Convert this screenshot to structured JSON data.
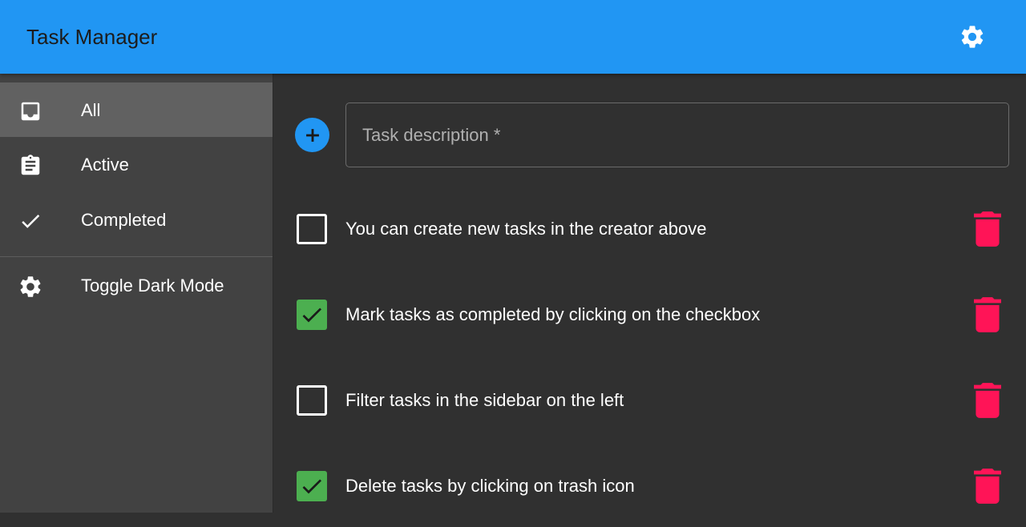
{
  "app": {
    "title": "Task Manager",
    "settings_icon": "gear-icon"
  },
  "sidebar": {
    "items": [
      {
        "label": "All",
        "icon": "inbox-icon",
        "selected": true
      },
      {
        "label": "Active",
        "icon": "clipboard-icon",
        "selected": false
      },
      {
        "label": "Completed",
        "icon": "checkmark-icon",
        "selected": false
      },
      {
        "label": "Toggle Dark Mode",
        "icon": "gear-icon",
        "selected": false
      }
    ]
  },
  "creator": {
    "placeholder": "Task description *",
    "value": "",
    "add_icon": "plus-circle-icon"
  },
  "tasks": [
    {
      "text": "You can create new tasks in the creator above",
      "completed": false
    },
    {
      "text": "Mark tasks as completed by clicking on the checkbox",
      "completed": true
    },
    {
      "text": "Filter tasks in the sidebar on the left",
      "completed": false
    },
    {
      "text": "Delete tasks by clicking on trash icon",
      "completed": true
    }
  ],
  "colors": {
    "primary": "#2196f3",
    "completed": "#4caf50",
    "delete": "#ff1457",
    "sidebar_bg": "#424242",
    "sidebar_selected": "#616161",
    "main_bg": "#303030"
  }
}
